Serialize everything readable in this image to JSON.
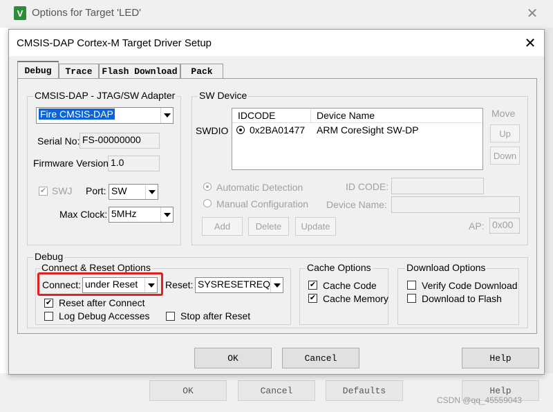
{
  "outer_window": {
    "title": "Options for Target 'LED'",
    "buttons": {
      "ok": "OK",
      "cancel": "Cancel",
      "defaults": "Defaults",
      "help": "Help"
    },
    "watermark": "CSDN @qq_45559043"
  },
  "dialog": {
    "title": "CMSIS-DAP Cortex-M Target Driver Setup",
    "tabs": [
      "Debug",
      "Trace",
      "Flash Download",
      "Pack"
    ],
    "active_tab": "Debug",
    "adapter": {
      "group_title": "CMSIS-DAP - JTAG/SW Adapter",
      "adapter_value": "Fire CMSIS-DAP",
      "serial_label": "Serial No:",
      "serial_value": "FS-00000000",
      "firmware_label": "Firmware Version:",
      "firmware_value": "1.0",
      "swj_label": "SWJ",
      "port_label": "Port:",
      "port_value": "SW",
      "maxclock_label": "Max Clock:",
      "maxclock_value": "5MHz"
    },
    "sw_device": {
      "group_title": "SW Device",
      "swdio_label": "SWDIO",
      "columns": [
        "IDCODE",
        "Device Name"
      ],
      "rows": [
        {
          "idcode": "0x2BA01477",
          "device": "ARM CoreSight SW-DP"
        }
      ],
      "move_label": "Move",
      "up": "Up",
      "down": "Down",
      "auto_detect": "Automatic Detection",
      "manual_config": "Manual Configuration",
      "id_code_label": "ID CODE:",
      "device_name_label": "Device Name:",
      "add": "Add",
      "delete": "Delete",
      "update": "Update",
      "ap_label": "AP:",
      "ap_value": "0x00"
    },
    "debug": {
      "group_title": "Debug",
      "connect_reset": {
        "group_title": "Connect & Reset Options",
        "connect_label": "Connect:",
        "connect_value": "under Reset",
        "reset_label": "Reset:",
        "reset_value": "SYSRESETREQ",
        "reset_after_connect": "Reset after Connect",
        "log_debug": "Log Debug Accesses",
        "stop_after_reset": "Stop after Reset"
      },
      "cache": {
        "group_title": "Cache Options",
        "cache_code": "Cache Code",
        "cache_memory": "Cache Memory"
      },
      "download": {
        "group_title": "Download Options",
        "verify": "Verify Code Download",
        "download_flash": "Download to Flash"
      }
    },
    "buttons": {
      "ok": "OK",
      "cancel": "Cancel",
      "help": "Help"
    },
    "highlight_color": "#e02020"
  }
}
